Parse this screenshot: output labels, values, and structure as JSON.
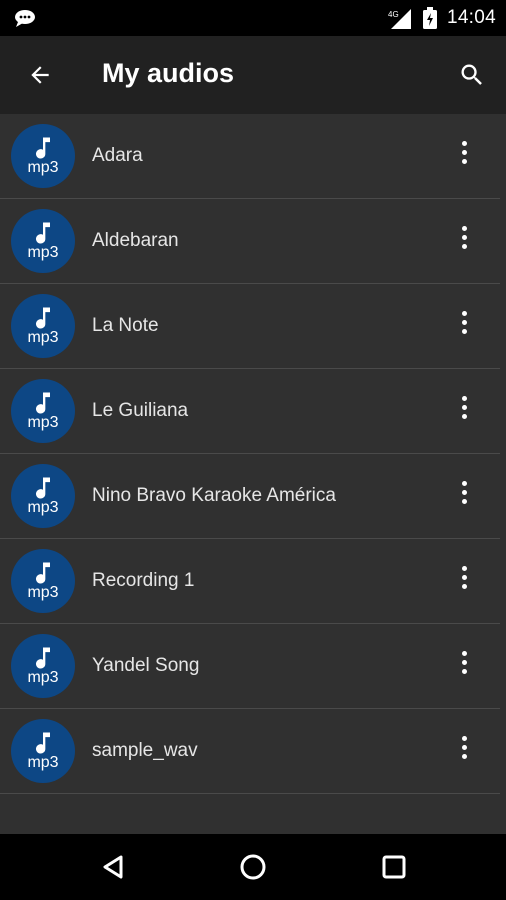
{
  "status_bar": {
    "time": "14:04",
    "icons": [
      "chat-bubble-icon",
      "signal-icon",
      "battery-charging-icon"
    ]
  },
  "app_bar": {
    "title": "My audios",
    "back_icon": "arrow-back-icon",
    "search_icon": "search-icon"
  },
  "audio_icon_label": "mp3",
  "audios": [
    {
      "name": "Adara"
    },
    {
      "name": "Aldebaran"
    },
    {
      "name": "La Note"
    },
    {
      "name": "Le Guiliana"
    },
    {
      "name": "Nino Bravo Karaoke América"
    },
    {
      "name": "Recording 1"
    },
    {
      "name": "Yandel Song"
    },
    {
      "name": "sample_wav"
    }
  ],
  "nav_bar": {
    "icons": [
      "back-triangle-icon",
      "home-circle-icon",
      "recents-square-icon"
    ]
  },
  "colors": {
    "background": "#303030",
    "app_bar": "#212121",
    "mp3_badge": "#0d4785",
    "divider": "#4a4a4a"
  }
}
